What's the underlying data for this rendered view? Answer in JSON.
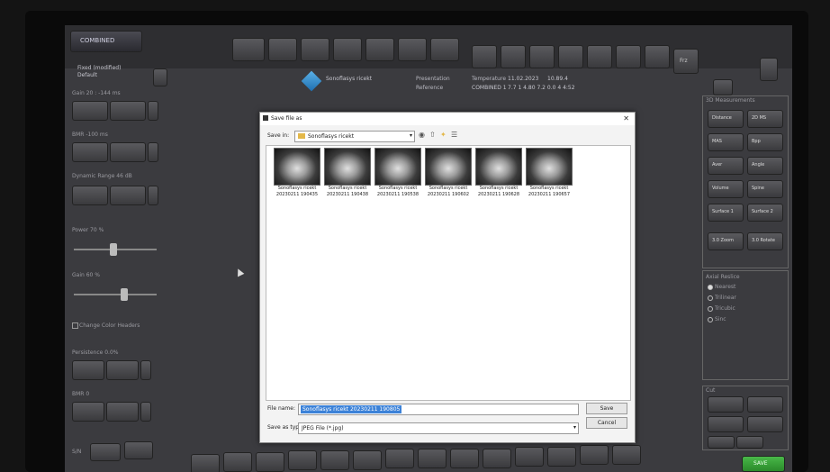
{
  "app": {
    "status_button": "COMBINED",
    "preset_name": "Fixed (modified)",
    "preset_sub": "Default"
  },
  "header": {
    "patient_name": "Sonoflasys ricekt",
    "param_label1": "Presentation",
    "param_label2": "Reference",
    "param_label3": "Temperature",
    "param_value1": "11.02.2023",
    "param_value2": "COMBINED 1",
    "param_value3": "10.89.4",
    "param_value4": "7.7 1   4.80 7.2 0.0 4   4:52",
    "freeze_label": "Frz"
  },
  "left_panel": {
    "labels": [
      "Gain  20 : -144 ms",
      "BMR  -100 ms",
      "Dynamic Range  46 dB",
      "Power  70 %",
      "Gain  60 %",
      "Change Color Headers",
      "Persistence  0.0%",
      "BMR  0"
    ],
    "bottom_label": "S/N"
  },
  "right_panel": {
    "group_title": "3D Measurements",
    "buttons": [
      "Distance",
      "2D MS",
      "MAS",
      "Bpp",
      "Aver",
      "Angle",
      "Volume",
      "Spine",
      "Surface 1",
      "Surface 2",
      "3.0 Zoom",
      "3.0 Rotate"
    ],
    "options_title": "Axial Reslice",
    "options": [
      "Nearest",
      "Trilinear",
      "Tricubic",
      "Sinc"
    ],
    "view_title": "Cut",
    "bottom_btn": "SAVE"
  },
  "dialog": {
    "title": "Save file as",
    "save_in_label": "Save in:",
    "save_in_value": "Sonoflasys ricekt",
    "files": [
      {
        "name": "Sonoflasys ricekt",
        "date": "20230211 190435"
      },
      {
        "name": "Sonoflasys ricekt",
        "date": "20230211 190438"
      },
      {
        "name": "Sonoflasys ricekt",
        "date": "20230211 190538"
      },
      {
        "name": "Sonoflasys ricekt",
        "date": "20230211 190602"
      },
      {
        "name": "Sonoflasys ricekt",
        "date": "20230211 190628"
      },
      {
        "name": "Sonoflasys ricekt",
        "date": "20230211 190657"
      }
    ],
    "file_name_label": "File name:",
    "file_name_value": "Sonoflasys ricekt 20230211 190805",
    "save_type_label": "Save as type:",
    "save_type_value": "JPEG File (*.jpg)",
    "save_button": "Save",
    "cancel_button": "Cancel"
  }
}
